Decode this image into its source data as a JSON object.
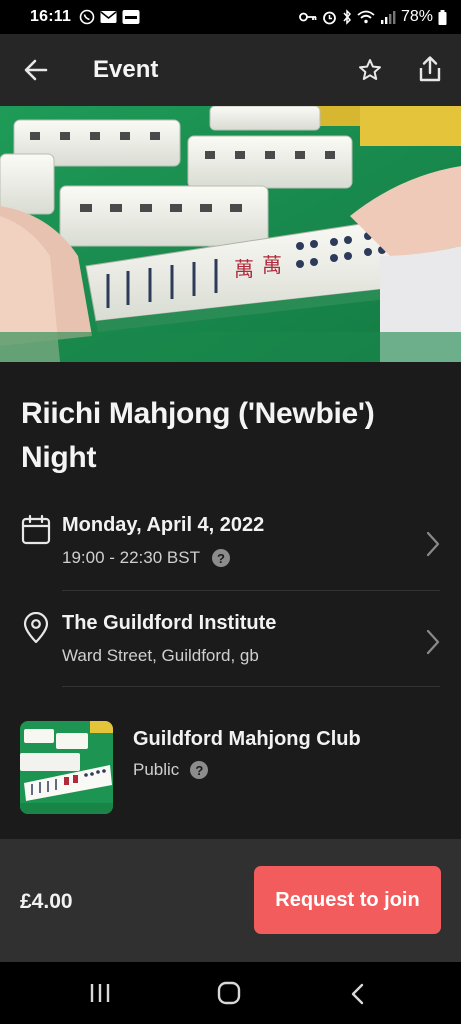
{
  "status_bar": {
    "time": "16:11",
    "battery": "78%"
  },
  "app_bar": {
    "title": "Event",
    "back_icon": "arrow-left-icon",
    "favorite_icon": "star-outline-icon",
    "share_icon": "share-icon"
  },
  "event": {
    "title": "Riichi Mahjong ('Newbie') Night",
    "date": "Monday, April 4, 2022",
    "time_range": "19:00 - 22:30 BST",
    "venue_name": "The Guildford Institute",
    "venue_address": "Ward Street, Guildford, gb"
  },
  "group": {
    "name": "Guildford Mahjong Club",
    "visibility": "Public"
  },
  "footer": {
    "price": "£4.00",
    "join_label": "Request to join"
  },
  "help_glyph": "?",
  "colors": {
    "background": "#1b1b1b",
    "app_bar": "#262626",
    "footer": "#303030",
    "accent": "#f25c5c"
  }
}
